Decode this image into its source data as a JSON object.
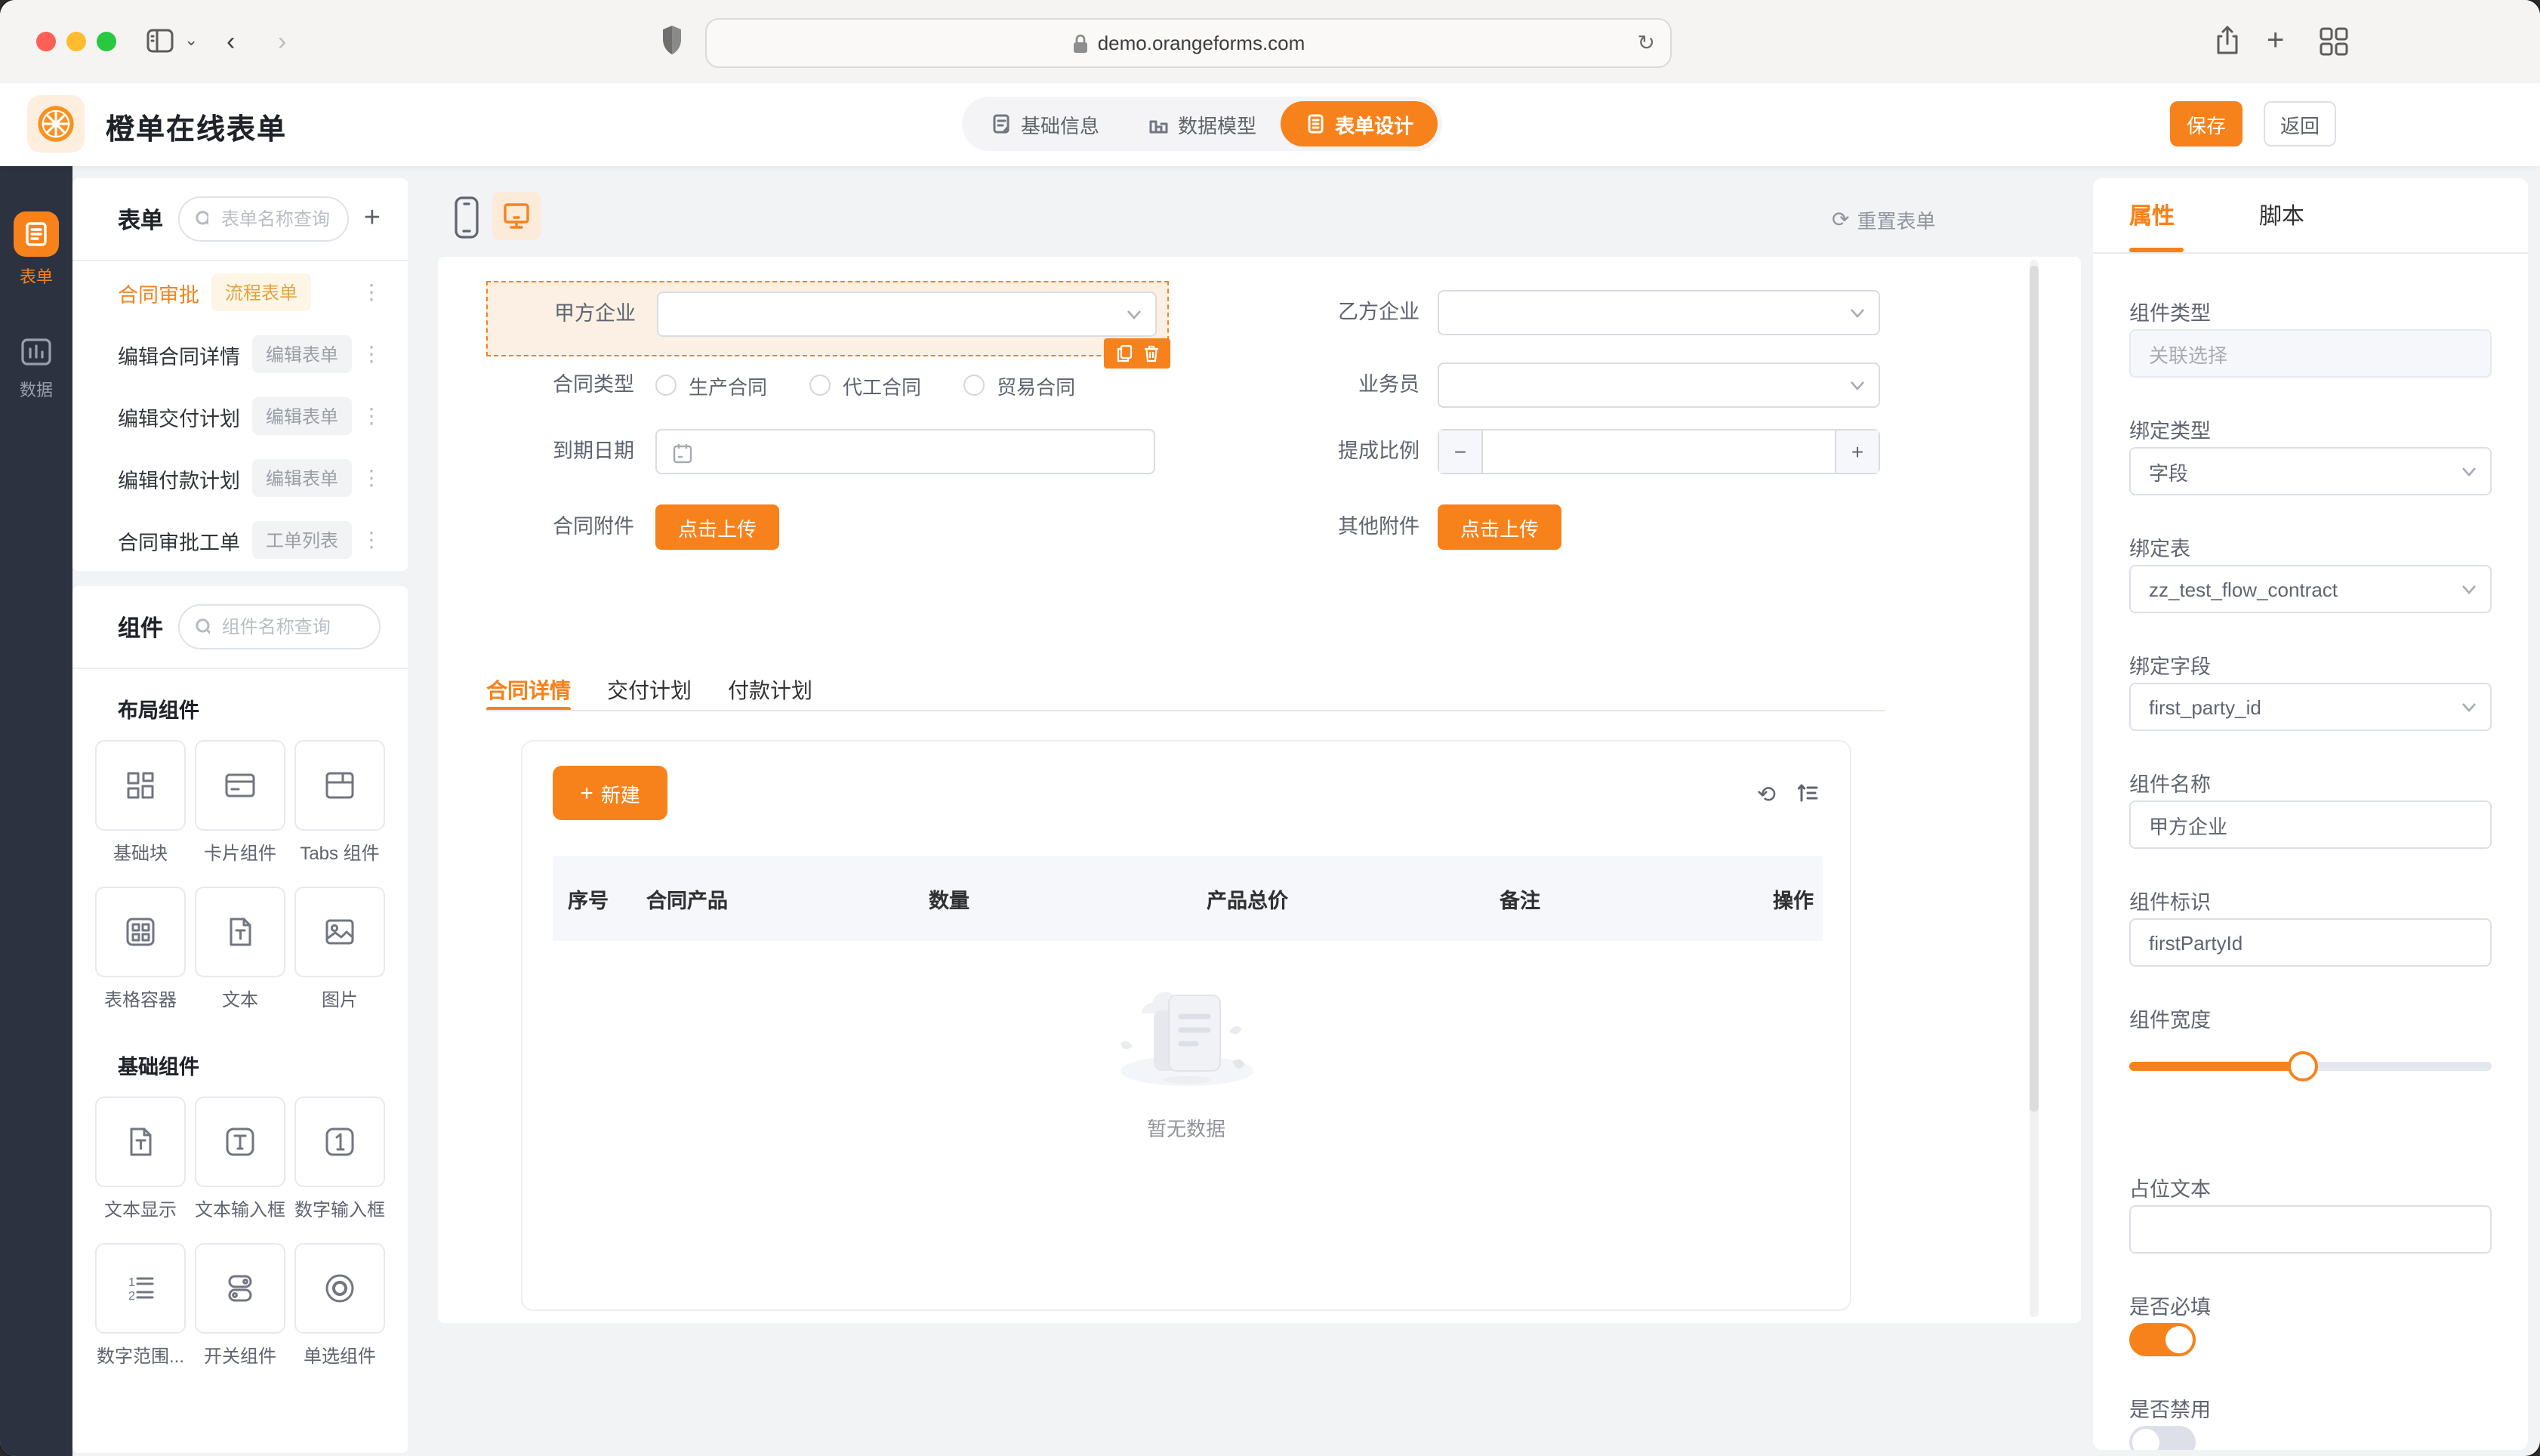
{
  "colors": {
    "accent": "#F7821B",
    "accent_light": "#FCF0E4",
    "warning_badge_bg": "#FDF6E7",
    "warning_badge_text": "#E2A23C",
    "rail_bg": "#2D3240"
  },
  "browser": {
    "url": "demo.orangeforms.com"
  },
  "app_header": {
    "title": "橙单在线表单",
    "nav": [
      {
        "label": "基础信息"
      },
      {
        "label": "数据模型"
      },
      {
        "label": "表单设计"
      }
    ],
    "save_label": "保存",
    "back_label": "返回"
  },
  "rail": {
    "items": [
      {
        "label": "表单"
      },
      {
        "label": "数据"
      }
    ]
  },
  "forms_panel": {
    "title": "表单",
    "search_placeholder": "表单名称查询",
    "items": [
      {
        "name": "合同审批",
        "badge": "流程表单"
      },
      {
        "name": "编辑合同详情",
        "badge": "编辑表单"
      },
      {
        "name": "编辑交付计划",
        "badge": "编辑表单"
      },
      {
        "name": "编辑付款计划",
        "badge": "编辑表单"
      },
      {
        "name": "合同审批工单",
        "badge": "工单列表"
      }
    ]
  },
  "components_panel": {
    "title": "组件",
    "search_placeholder": "组件名称查询",
    "groups": [
      {
        "title": "布局组件",
        "items": [
          {
            "label": "基础块"
          },
          {
            "label": "卡片组件"
          },
          {
            "label": "Tabs 组件"
          },
          {
            "label": "表格容器"
          },
          {
            "label": "文本"
          },
          {
            "label": "图片"
          }
        ]
      },
      {
        "title": "基础组件",
        "items": [
          {
            "label": "文本显示"
          },
          {
            "label": "文本输入框"
          },
          {
            "label": "数字输入框"
          },
          {
            "label": "数字范围..."
          },
          {
            "label": "开关组件"
          },
          {
            "label": "单选组件"
          }
        ]
      }
    ]
  },
  "canvas": {
    "reset_label": "重置表单",
    "form": {
      "first_party": {
        "label": "甲方企业"
      },
      "second_party": {
        "label": "乙方企业"
      },
      "contract_type": {
        "label": "合同类型",
        "options": [
          "生产合同",
          "代工合同",
          "贸易合同"
        ]
      },
      "salesman": {
        "label": "业务员"
      },
      "due_date": {
        "label": "到期日期"
      },
      "commission": {
        "label": "提成比例",
        "minus": "−",
        "plus": "+"
      },
      "contract_attachment": {
        "label": "合同附件",
        "button": "点击上传"
      },
      "other_attachment": {
        "label": "其他附件",
        "button": "点击上传"
      }
    },
    "tabs": [
      {
        "label": "合同详情"
      },
      {
        "label": "交付计划"
      },
      {
        "label": "付款计划"
      }
    ],
    "table": {
      "create_label": "新建",
      "columns": [
        "序号",
        "合同产品",
        "数量",
        "产品总价",
        "备注",
        "操作"
      ],
      "empty_text": "暂无数据"
    }
  },
  "props_panel": {
    "tabs": [
      {
        "label": "属性"
      },
      {
        "label": "脚本"
      }
    ],
    "fields": {
      "component_type": {
        "label": "组件类型",
        "value": "关联选择"
      },
      "bind_type": {
        "label": "绑定类型",
        "value": "字段"
      },
      "bind_table": {
        "label": "绑定表",
        "value": "zz_test_flow_contract"
      },
      "bind_field": {
        "label": "绑定字段",
        "value": "first_party_id"
      },
      "component_name": {
        "label": "组件名称",
        "value": "甲方企业"
      },
      "component_key": {
        "label": "组件标识",
        "value": "firstPartyId"
      },
      "component_width": {
        "label": "组件宽度",
        "percent": 48
      },
      "placeholder_text": {
        "label": "占位文本",
        "value": ""
      },
      "required": {
        "label": "是否必填",
        "on": true
      },
      "disabled": {
        "label": "是否禁用",
        "on": false
      }
    }
  }
}
